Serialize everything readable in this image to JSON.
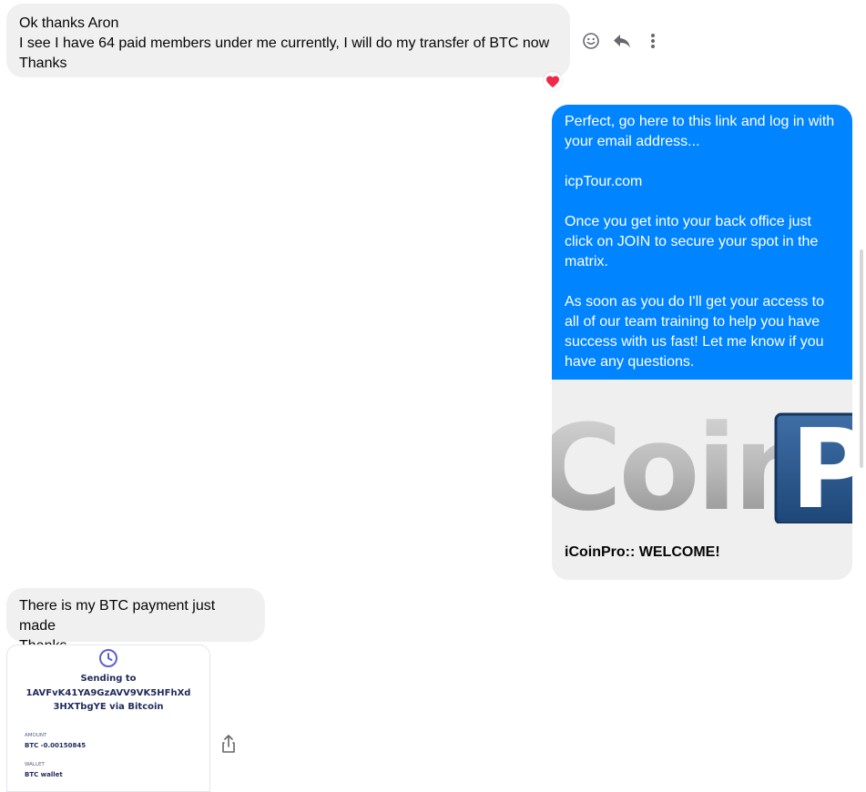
{
  "messages": {
    "incoming_1": "Ok thanks Aron\nI see I have 64 paid members under me currently, I will do my transfer of BTC now\nThanks",
    "reaction": "heart",
    "outgoing_1": "Perfect, go here to this link and log in with your email address...\n\nicpTour.com\n\nOnce you get into your back office just click on JOIN to secure your spot in the matrix.\n\nAs soon as you do I'll get your access to all of our team training to help you have success with us fast! Let me know if you have any questions.",
    "link_preview": {
      "logo_text_1": "Coin",
      "logo_text_2": "Pr",
      "caption": "iCoinPro:: WELCOME!"
    },
    "incoming_2": "There is my BTC payment just made\nThanks"
  },
  "payment_card": {
    "title_line_1": "Sending to",
    "title_line_2": "1AVFvK41YA9GzAVV9VK5HFhXd",
    "title_line_3": "3HXTbgYE via Bitcoin",
    "amount_label": "AMOUNT",
    "amount_value": "BTC -0.00150845",
    "wallet_label": "WALLET",
    "wallet_value": "BTC wallet"
  },
  "icons": {
    "react": "smiley-icon",
    "reply": "reply-icon",
    "more": "more-vertical-icon",
    "share": "share-icon",
    "pending": "clock-icon"
  },
  "colors": {
    "outgoing_bubble": "#0084ff",
    "incoming_bubble": "#f0f0f0",
    "heart": "#f02849",
    "card_accent": "#5b5fd6"
  }
}
